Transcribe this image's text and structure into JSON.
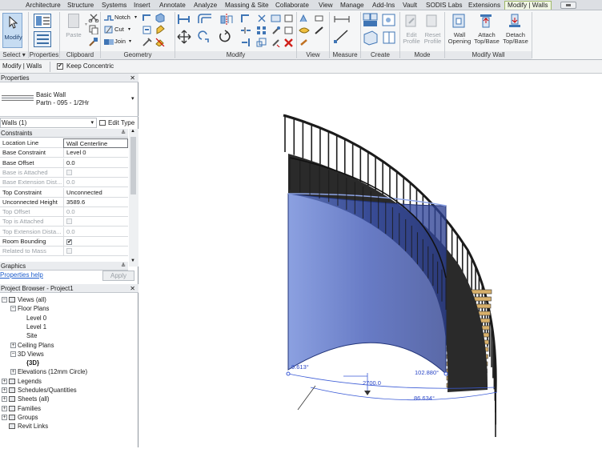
{
  "menubar": {
    "tabs": [
      "Architecture",
      "Structure",
      "Systems",
      "Insert",
      "Annotate",
      "Analyze",
      "Massing & Site",
      "Collaborate",
      "View",
      "Manage",
      "Add-Ins",
      "Vault",
      "SODIS Labs",
      "Extensions",
      "Modify | Walls"
    ],
    "active_tab": "Modify | Walls"
  },
  "ribbon": {
    "panels": {
      "select": "Select",
      "properties": "Properties",
      "clipboard": "Clipboard",
      "geometry": "Geometry",
      "modify": "Modify",
      "view": "View",
      "measure": "Measure",
      "create": "Create",
      "mode": "Mode",
      "modify_wall": "Modify Wall"
    },
    "modify_button": "Modify",
    "paste_button": "Paste",
    "notch_button": "Notch",
    "cut_button": "Cut",
    "join_button": "Join",
    "edit_profile": [
      "Edit",
      "Profile"
    ],
    "reset_profile": [
      "Reset",
      "Profile"
    ],
    "wall_opening": [
      "Wall",
      "Opening"
    ],
    "attach_top_base": [
      "Attach",
      "Top/Base"
    ],
    "detach_top_base": [
      "Detach",
      "Top/Base"
    ]
  },
  "optionsbar": {
    "context": "Modify | Walls",
    "keep_concentric_label": "Keep Concentric",
    "keep_concentric_checked": true
  },
  "properties": {
    "title": "Properties",
    "type_family": "Basic Wall",
    "type_name": "Partn - 095 - 1/2Hr",
    "instance_selector": "Walls (1)",
    "edit_type": "Edit Type",
    "section_constraints": "Constraints",
    "rows": [
      {
        "key": "Location Line",
        "value": "Wall Centerline",
        "dim": false,
        "check": null
      },
      {
        "key": "Base Constraint",
        "value": "Level 0",
        "dim": false,
        "check": null
      },
      {
        "key": "Base Offset",
        "value": "0.0",
        "dim": false,
        "check": null
      },
      {
        "key": "Base is Attached",
        "value": "",
        "dim": true,
        "check": false
      },
      {
        "key": "Base Extension Dist...",
        "value": "0.0",
        "dim": true,
        "check": null
      },
      {
        "key": "Top Constraint",
        "value": "Unconnected",
        "dim": false,
        "check": null
      },
      {
        "key": "Unconnected Height",
        "value": "3589.6",
        "dim": false,
        "check": null
      },
      {
        "key": "Top Offset",
        "value": "0.0",
        "dim": true,
        "check": null
      },
      {
        "key": "Top is Attached",
        "value": "",
        "dim": true,
        "check": false
      },
      {
        "key": "Top Extension Dista...",
        "value": "0.0",
        "dim": true,
        "check": null
      },
      {
        "key": "Room Bounding",
        "value": "",
        "dim": false,
        "check": true
      },
      {
        "key": "Related to Mass",
        "value": "",
        "dim": true,
        "check": false
      }
    ],
    "section_graphics": "Graphics",
    "help_link": "Properties help",
    "apply_button": "Apply"
  },
  "browser": {
    "title": "Project Browser - Project1",
    "nodes": [
      {
        "label": "Views (all)",
        "level": 0,
        "exp": "-",
        "icon": true
      },
      {
        "label": "Floor Plans",
        "level": 1,
        "exp": "-",
        "icon": false
      },
      {
        "label": "Level 0",
        "level": 2,
        "exp": "",
        "icon": false
      },
      {
        "label": "Level 1",
        "level": 2,
        "exp": "",
        "icon": false
      },
      {
        "label": "Site",
        "level": 2,
        "exp": "",
        "icon": false
      },
      {
        "label": "Ceiling Plans",
        "level": 1,
        "exp": "+",
        "icon": false
      },
      {
        "label": "3D Views",
        "level": 1,
        "exp": "-",
        "icon": false
      },
      {
        "label": "{3D}",
        "level": 2,
        "exp": "",
        "icon": false,
        "bold": true
      },
      {
        "label": "Elevations (12mm Circle)",
        "level": 1,
        "exp": "+",
        "icon": false
      },
      {
        "label": "Legends",
        "level": 0,
        "exp": "+",
        "icon": true
      },
      {
        "label": "Schedules/Quantities",
        "level": 0,
        "exp": "+",
        "icon": true
      },
      {
        "label": "Sheets (all)",
        "level": 0,
        "exp": "+",
        "icon": true
      },
      {
        "label": "Families",
        "level": 0,
        "exp": "+",
        "icon": true
      },
      {
        "label": "Groups",
        "level": 0,
        "exp": "+",
        "icon": true
      },
      {
        "label": "Revit Links",
        "level": 0,
        "exp": "",
        "icon": true
      }
    ]
  },
  "viewport": {
    "dim_left": "9.613°",
    "dim_right": "102.880°",
    "dim_radius": "2700.0",
    "dim_arc": "86.634°",
    "wall_color": "#4a6ad0",
    "tread_color": "#d8b06a"
  }
}
